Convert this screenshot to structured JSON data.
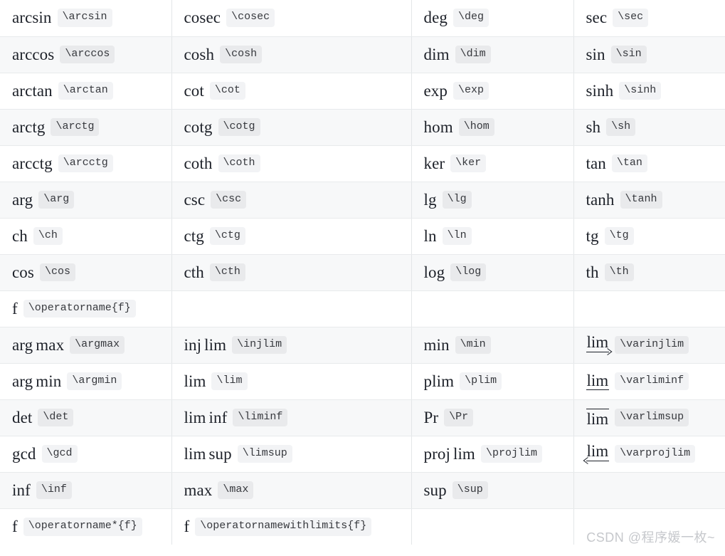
{
  "document": {
    "kind": "latex-operator-reference-table",
    "columns": 4,
    "watermark": "CSDN @程序媛一枚~"
  },
  "colors": {
    "text": "#1d2129",
    "code_text": "#36383d",
    "code_bg": "#f2f3f5",
    "code_bg_alt": "#e9eaec",
    "row_alt_bg": "#f7f8f9",
    "row_bg": "#ffffff",
    "border": "#e8eaec",
    "watermark": "#c6c8cc"
  },
  "rows": [
    [
      {
        "name": "arcsin",
        "cmd": "\\arcsin"
      },
      {
        "name": "cosec",
        "cmd": "\\cosec"
      },
      {
        "name": "deg",
        "cmd": "\\deg"
      },
      {
        "name": "sec",
        "cmd": "\\sec"
      }
    ],
    [
      {
        "name": "arccos",
        "cmd": "\\arccos"
      },
      {
        "name": "cosh",
        "cmd": "\\cosh"
      },
      {
        "name": "dim",
        "cmd": "\\dim"
      },
      {
        "name": "sin",
        "cmd": "\\sin"
      }
    ],
    [
      {
        "name": "arctan",
        "cmd": "\\arctan"
      },
      {
        "name": "cot",
        "cmd": "\\cot"
      },
      {
        "name": "exp",
        "cmd": "\\exp"
      },
      {
        "name": "sinh",
        "cmd": "\\sinh"
      }
    ],
    [
      {
        "name": "arctg",
        "cmd": "\\arctg"
      },
      {
        "name": "cotg",
        "cmd": "\\cotg"
      },
      {
        "name": "hom",
        "cmd": "\\hom"
      },
      {
        "name": "sh",
        "cmd": "\\sh"
      }
    ],
    [
      {
        "name": "arcctg",
        "cmd": "\\arcctg"
      },
      {
        "name": "coth",
        "cmd": "\\coth"
      },
      {
        "name": "ker",
        "cmd": "\\ker"
      },
      {
        "name": "tan",
        "cmd": "\\tan"
      }
    ],
    [
      {
        "name": "arg",
        "cmd": "\\arg"
      },
      {
        "name": "csc",
        "cmd": "\\csc"
      },
      {
        "name": "lg",
        "cmd": "\\lg"
      },
      {
        "name": "tanh",
        "cmd": "\\tanh"
      }
    ],
    [
      {
        "name": "ch",
        "cmd": "\\ch"
      },
      {
        "name": "ctg",
        "cmd": "\\ctg"
      },
      {
        "name": "ln",
        "cmd": "\\ln"
      },
      {
        "name": "tg",
        "cmd": "\\tg"
      }
    ],
    [
      {
        "name": "cos",
        "cmd": "\\cos"
      },
      {
        "name": "cth",
        "cmd": "\\cth"
      },
      {
        "name": "log",
        "cmd": "\\log"
      },
      {
        "name": "th",
        "cmd": "\\th"
      }
    ],
    [
      {
        "name": "f",
        "cmd": "\\operatorname{f}"
      },
      {
        "name": "",
        "cmd": ""
      },
      {
        "name": "",
        "cmd": ""
      },
      {
        "name": "",
        "cmd": ""
      }
    ],
    [
      {
        "name": "arg max",
        "cmd": "\\argmax"
      },
      {
        "name": "inj lim",
        "cmd": "\\injlim"
      },
      {
        "name": "min",
        "cmd": "\\min"
      },
      {
        "name": "lim",
        "cmd": "\\varinjlim",
        "decoration": "arrow-right-under"
      }
    ],
    [
      {
        "name": "arg min",
        "cmd": "\\argmin"
      },
      {
        "name": "lim",
        "cmd": "\\lim"
      },
      {
        "name": "plim",
        "cmd": "\\plim"
      },
      {
        "name": "lim",
        "cmd": "\\varliminf",
        "decoration": "bar-under"
      }
    ],
    [
      {
        "name": "det",
        "cmd": "\\det"
      },
      {
        "name": "lim inf",
        "cmd": "\\liminf"
      },
      {
        "name": "Pr",
        "cmd": "\\Pr"
      },
      {
        "name": "lim",
        "cmd": "\\varlimsup",
        "decoration": "bar-over"
      }
    ],
    [
      {
        "name": "gcd",
        "cmd": "\\gcd"
      },
      {
        "name": "lim sup",
        "cmd": "\\limsup"
      },
      {
        "name": "proj lim",
        "cmd": "\\projlim"
      },
      {
        "name": "lim",
        "cmd": "\\varprojlim",
        "decoration": "arrow-left-under"
      }
    ],
    [
      {
        "name": "inf",
        "cmd": "\\inf"
      },
      {
        "name": "max",
        "cmd": "\\max"
      },
      {
        "name": "sup",
        "cmd": "\\sup"
      },
      {
        "name": "",
        "cmd": ""
      }
    ],
    [
      {
        "name": "f",
        "cmd": "\\operatorname*{f}"
      },
      {
        "name": "f",
        "cmd": "\\operatornamewithlimits{f}"
      },
      {
        "name": "",
        "cmd": ""
      },
      {
        "name": "",
        "cmd": ""
      }
    ]
  ]
}
